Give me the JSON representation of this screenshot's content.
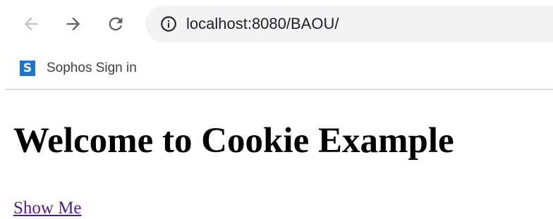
{
  "browser": {
    "url": "localhost:8080/BAOU/",
    "bookmarks": [
      {
        "icon_letter": "S",
        "label": "Sophos Sign in"
      }
    ],
    "colors": {
      "toolbar_bg": "#ffffff",
      "omnibox_bg": "#f1f3f4",
      "back_disabled": "#bdc1c6",
      "icon_active": "#5f6368",
      "sophos_blue": "#1f74c7",
      "divider": "#dadce0"
    },
    "icons": {
      "back": "arrow-left-icon",
      "forward": "arrow-right-icon",
      "reload": "reload-icon",
      "site_info": "info-circle-icon",
      "bookmark": "sophos-icon"
    }
  },
  "page": {
    "heading": "Welcome to Cookie Example",
    "link": "Show Me",
    "colors": {
      "heading": "#000000",
      "visited_link": "#551a8b"
    }
  }
}
